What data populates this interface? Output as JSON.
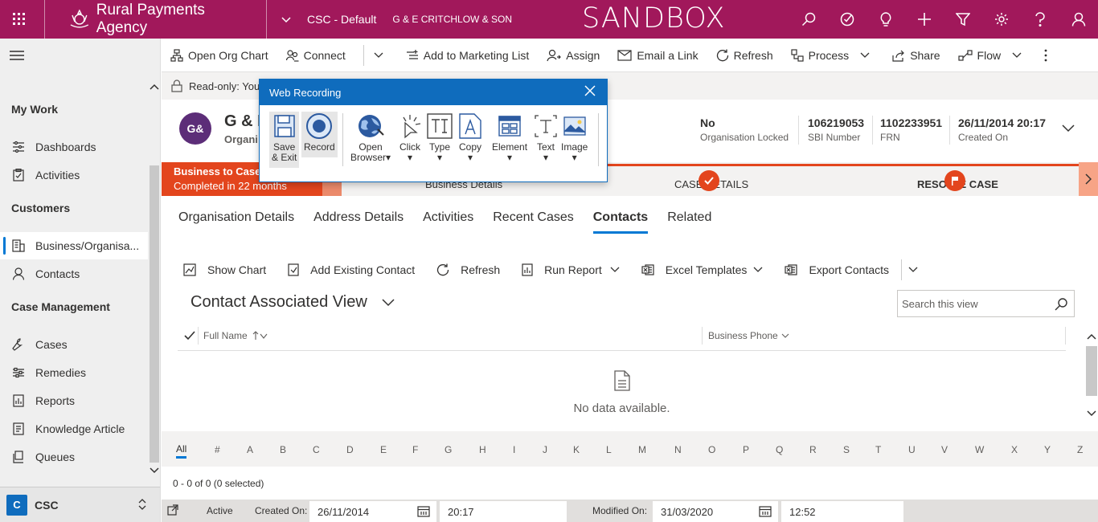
{
  "topbar": {
    "brand": "Rural Payments Agency",
    "app_name": "CSC - Default",
    "record_name": "G & E CRITCHLOW & SON",
    "environment": "SANDBOX",
    "bg_color": "#a1185b"
  },
  "leftnav": {
    "my_work": "My Work",
    "dashboards": "Dashboards",
    "activities": "Activities",
    "customers": "Customers",
    "business": "Business/Organisa...",
    "contacts": "Contacts",
    "case_management": "Case Management",
    "cases": "Cases",
    "remedies": "Remedies",
    "reports": "Reports",
    "knowledge": "Knowledge Article",
    "queues": "Queues",
    "area_badge": "C",
    "area_label": "CSC"
  },
  "commandbar": {
    "open_org_chart": "Open Org Chart",
    "connect": "Connect",
    "add_marketing": "Add to Marketing List",
    "assign": "Assign",
    "email_link": "Email a Link",
    "refresh": "Refresh",
    "process": "Process",
    "share": "Share",
    "flow": "Flow"
  },
  "readonly": "Read-only: You c",
  "header": {
    "avatar": "G&",
    "name": "G & E",
    "subtitle": "Organi",
    "org_locked_value": "No",
    "org_locked_label": "Organisation Locked",
    "sbi_value": "106219053",
    "sbi_label": "SBI Number",
    "frn_value": "1102233951",
    "frn_label": "FRN",
    "created_value": "26/11/2014 20:17",
    "created_label": "Created On"
  },
  "bpf": {
    "stage_title": "Business to Case",
    "stage_sub": "Completed in 22 months",
    "stage1": "Business Details",
    "stage2": "CASE DETAILS",
    "stage3": "RESOLVE CASE",
    "accent": "#e3451d"
  },
  "tabs": [
    "Organisation Details",
    "Address Details",
    "Activities",
    "Recent Cases",
    "Contacts",
    "Related"
  ],
  "subcmd": {
    "show_chart": "Show Chart",
    "add_existing": "Add Existing Contact",
    "refresh": "Refresh",
    "run_report": "Run Report",
    "excel": "Excel Templates",
    "export": "Export Contacts"
  },
  "view": {
    "title": "Contact Associated View",
    "search_placeholder": "Search this view",
    "col_fullname": "Full Name",
    "col_phone": "Business Phone",
    "empty": "No data available."
  },
  "alphabet": [
    "All",
    "#",
    "A",
    "B",
    "C",
    "D",
    "E",
    "F",
    "G",
    "H",
    "I",
    "J",
    "K",
    "L",
    "M",
    "N",
    "O",
    "P",
    "Q",
    "R",
    "S",
    "T",
    "U",
    "V",
    "W",
    "X",
    "Y",
    "Z"
  ],
  "count": "0 - 0 of 0 (0 selected)",
  "footer": {
    "status": "Active",
    "created_label": "Created On:",
    "created_date": "26/11/2014",
    "created_time": "20:17",
    "modified_label": "Modified On:",
    "modified_date": "31/03/2020",
    "modified_time": "12:52"
  },
  "popup": {
    "title": "Web Recording",
    "save_exit_1": "Save",
    "save_exit_2": "& Exit",
    "record": "Record",
    "open_browser_1": "Open",
    "open_browser_2": "Browser",
    "click": "Click",
    "type": "Type",
    "copy": "Copy",
    "element": "Element",
    "text": "Text",
    "image": "Image",
    "accent": "#0f6cbd"
  }
}
